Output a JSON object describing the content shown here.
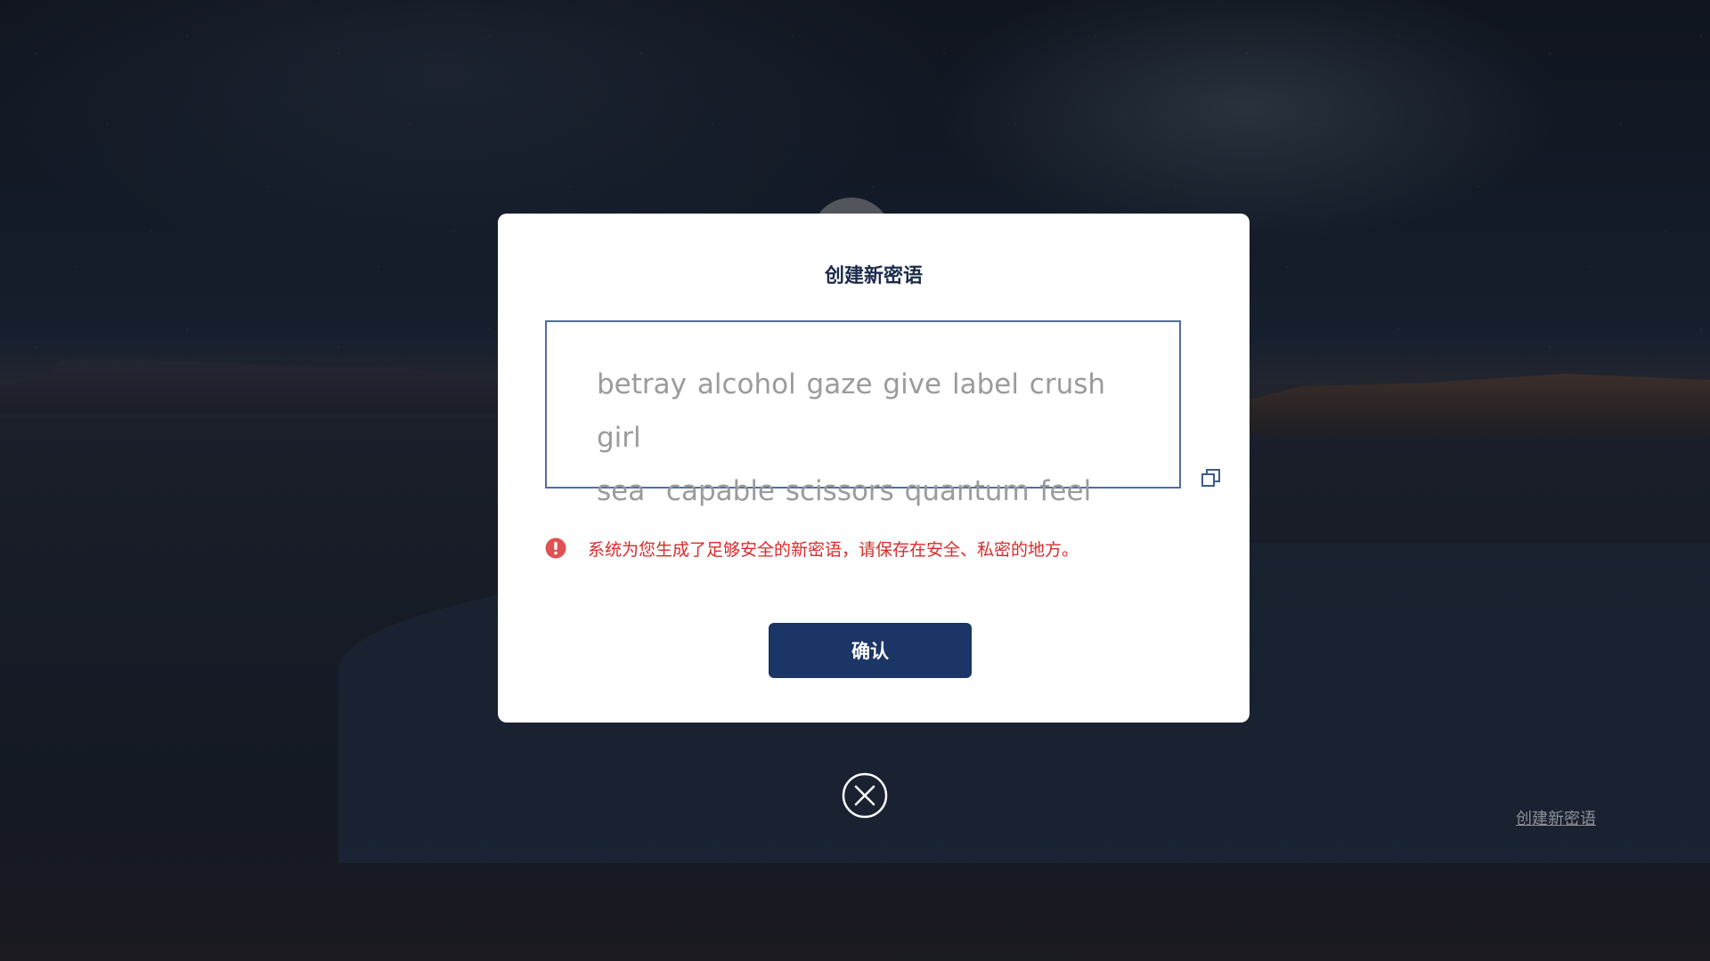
{
  "dialog": {
    "title": "创建新密语",
    "phrase_line1": "betray alcohol gaze give label crush girl",
    "phrase_line2": "sea  capable scissors quantum feel",
    "warning": "系统为您生成了足够安全的新密语，请保存在安全、私密的地方。",
    "confirm_label": "确认"
  },
  "footer": {
    "create_new_link": "创建新密语"
  },
  "colors": {
    "title": "#1d2b4c",
    "phrase_border": "#506f9a",
    "phrase_text": "#9b9b9b",
    "warning": "#d92b2b",
    "warning_icon": "#e05252",
    "primary_button": "#1a3566",
    "dialog_bg": "#ffffff"
  },
  "icons": {
    "copy": "copy-icon",
    "warning": "exclamation-circle-icon",
    "close": "close-circle-icon"
  }
}
